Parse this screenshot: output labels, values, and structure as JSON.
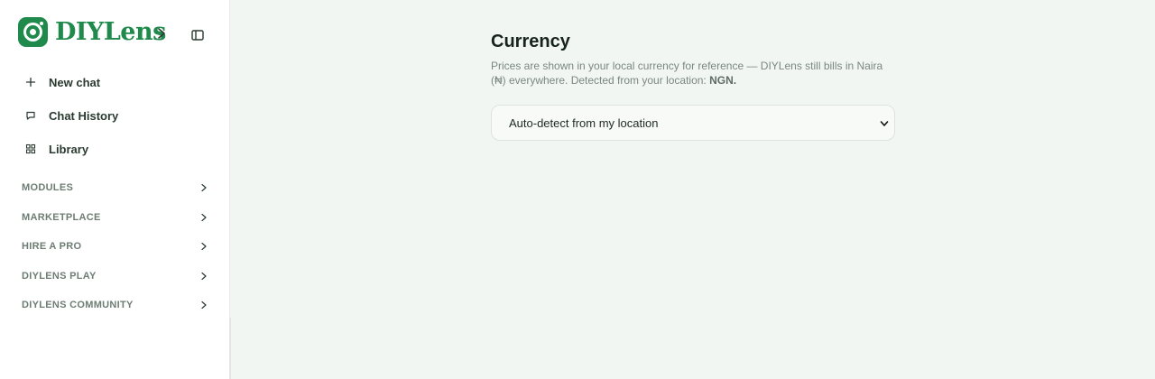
{
  "brand": {
    "name": "DIYLens",
    "icon": "camera-lens-logo",
    "accent": "#1f8a4c"
  },
  "sidebar": {
    "nav": [
      {
        "label": "New chat",
        "icon": "plus-icon"
      },
      {
        "label": "Chat History",
        "icon": "chat-bubble-icon"
      },
      {
        "label": "Library",
        "icon": "grid-icon"
      }
    ],
    "sections": [
      {
        "label": "MODULES"
      },
      {
        "label": "MARKETPLACE"
      },
      {
        "label": "HIRE A PRO"
      },
      {
        "label": "DIYLENS PLAY"
      },
      {
        "label": "DIYLENS COMMUNITY"
      }
    ]
  },
  "main": {
    "title": "Currency",
    "description": "Prices are shown in your local currency for reference — DIYLens still bills in Naira (₦) everywhere. Detected from your location: ",
    "detected_code": "NGN",
    "description_end": ".",
    "select": {
      "value": "Auto-detect from my location"
    }
  }
}
